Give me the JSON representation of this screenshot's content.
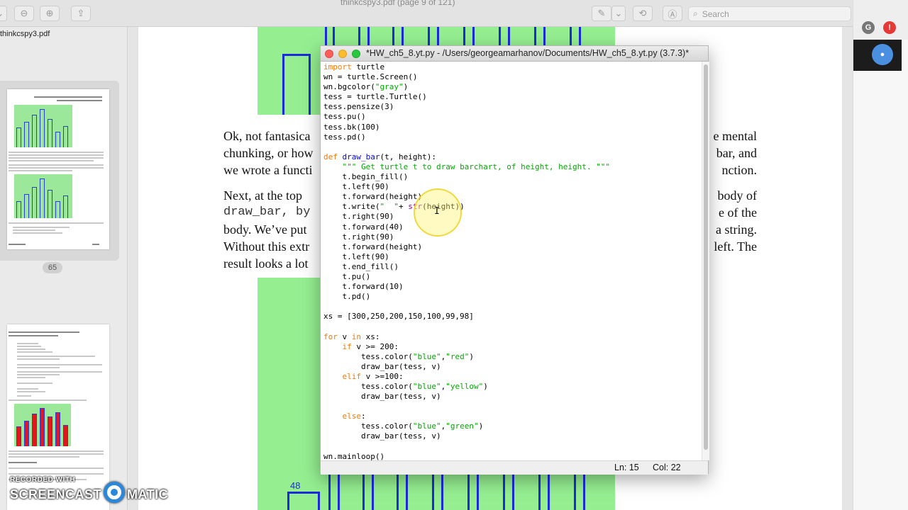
{
  "preview": {
    "doc_title": "thinkcspy3.pdf (page 9 of 121)",
    "sidebar_filename": "thinkcspy3.pdf",
    "page_number": "65",
    "search_placeholder": "Search"
  },
  "pdf_text": {
    "line1_left": "Ok, not fantasica",
    "line1_right": "e mental",
    "line2_left": "chunking, or how",
    "line2_right": "bar, and",
    "line3_left": "we wrote a functi",
    "line3_right": "nction.",
    "line4_left": "Next, at the top",
    "line4_right": "body of",
    "line5_left": "draw_bar, by",
    "line5_right": "e of the",
    "line6_left": "body.  We’ve put",
    "line6_right": "a string.",
    "line7_left": "Without this extr",
    "line7_right": "left.  The",
    "line8_left": "result looks a lot",
    "plot_label": "48"
  },
  "idle": {
    "title": "*HW_ch5_8.yt.py - /Users/georgeamarhanov/Documents/HW_ch5_8.yt.py (3.7.3)*",
    "status_ln": "Ln: 15",
    "status_col": "Col: 22"
  },
  "watermark": {
    "top": "RECORDED WITH",
    "left": "SCREENCAST",
    "right": "MATIC"
  },
  "chrome": {
    "avatar_letter": "G"
  },
  "colors": {
    "plot_green": "#95ef91",
    "bar_blue": "#1b2bdc",
    "keyword": "#ff7700",
    "string": "#00aa00",
    "defname": "#0000ff"
  }
}
